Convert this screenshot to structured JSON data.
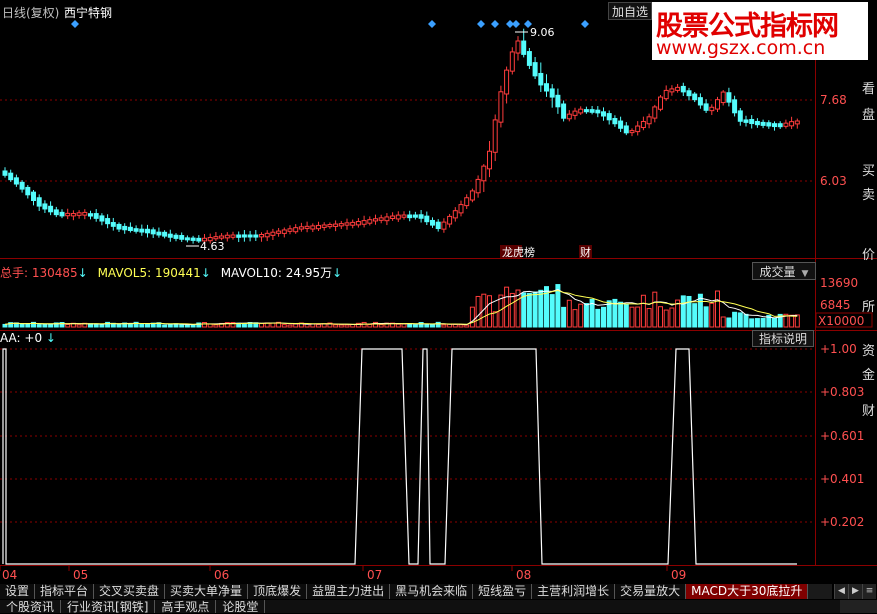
{
  "header": {
    "chart_type": "日线(复权)",
    "stock_name": "西宁特钢",
    "add_watch": "加自选"
  },
  "watermark": {
    "line1": "股票公式指标网",
    "line2": "www.gszx.com.cn"
  },
  "side_labels": [
    "看",
    "盘",
    "买",
    "卖",
    "价",
    "所",
    "资",
    "金",
    "财"
  ],
  "price_pane": {
    "axis_labels": [
      "7.68",
      "6.03"
    ],
    "high_label": "9.06",
    "low_label": "4.63",
    "markers": [
      "龙虎榜",
      "财"
    ]
  },
  "volume_pane": {
    "legend_total": "总手: 130485",
    "legend_ma5": "MAVOL5: 190441",
    "legend_ma10": "MAVOL10: 24.95万",
    "selector": "成交量",
    "axis_labels": [
      "13690",
      "6845"
    ],
    "unit": "X10000"
  },
  "indicator_pane": {
    "legend": "AA: +0",
    "explain_button": "指标说明",
    "axis_labels": [
      "+1.00",
      "+0.803",
      "+0.601",
      "+0.401",
      "+0.202"
    ]
  },
  "x_axis_labels": [
    "04",
    "05",
    "06",
    "07",
    "08",
    "09"
  ],
  "bottom_tabs": [
    "设置",
    "指标平台",
    "交叉买卖盘",
    "买卖大单净量",
    "顶底爆发",
    "益盟主力进出",
    "黑马机会来临",
    "短线盈亏",
    "主营利润增长",
    "交易量放大",
    "MACD大于30底拉升"
  ],
  "bottom_tabs2": [
    "个股资讯",
    "行业资讯[钢铁]",
    "高手观点",
    "论股堂"
  ],
  "colors": {
    "up": "#ff3c3c",
    "down": "#54fcfc",
    "ma5": "#ffffff",
    "ma10": "#ffff54",
    "grid": "#8b0000",
    "indicator": "#ffffff",
    "diamond": "#3ba0ff"
  }
}
